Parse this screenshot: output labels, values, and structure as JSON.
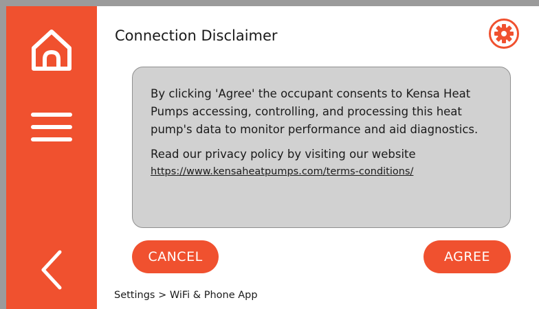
{
  "header": {
    "title": "Connection Disclaimer",
    "settings_icon": "gear-icon"
  },
  "sidebar": {
    "items": [
      {
        "icon": "home-icon"
      },
      {
        "icon": "menu-icon"
      },
      {
        "icon": "back-arrow-icon"
      }
    ]
  },
  "disclaimer": {
    "body": "By clicking 'Agree' the occupant consents to Kensa Heat Pumps accessing, controlling, and processing this heat pump's data to monitor performance and aid diagnostics.",
    "privacy_text": "Read our privacy policy by visiting our website",
    "privacy_link": "https://www.kensaheatpumps.com/terms-conditions/"
  },
  "buttons": {
    "cancel_label": "CANCEL",
    "agree_label": "AGREE"
  },
  "breadcrumb": "Settings > WiFi & Phone App",
  "colors": {
    "accent": "#f0512f",
    "panel": "#d1d1d1",
    "frame": "#9b9b9b"
  }
}
